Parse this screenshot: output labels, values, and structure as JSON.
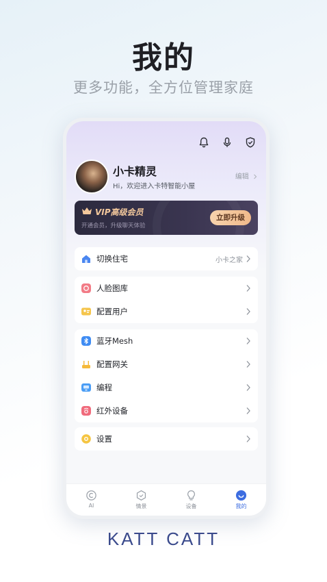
{
  "hero": {
    "title": "我的",
    "subtitle": "更多功能，全方位管理家庭"
  },
  "profile": {
    "name": "小卡精灵",
    "greeting": "Hi，欢迎进入卡特智能小屋",
    "edit": "编辑"
  },
  "vip": {
    "title": "VIP高级会员",
    "desc": "开通会员，升级聊天体验",
    "button": "立即升级"
  },
  "menu": {
    "house": {
      "label": "切换住宅",
      "value": "小卡之家"
    },
    "group1": [
      {
        "label": "人脸图库"
      },
      {
        "label": "配置用户"
      }
    ],
    "group2": [
      {
        "label": "蓝牙Mesh"
      },
      {
        "label": "配置网关"
      },
      {
        "label": "编程"
      },
      {
        "label": "红外设备"
      }
    ],
    "settings": {
      "label": "设置"
    }
  },
  "tabs": [
    {
      "label": "AI"
    },
    {
      "label": "情景"
    },
    {
      "label": "设备"
    },
    {
      "label": "我的"
    }
  ],
  "brand": "KATT CATT",
  "colors": {
    "accent": "#3d6de0",
    "vip_gold": "#f3c89c",
    "vip_bg": "#2c2a3e"
  }
}
